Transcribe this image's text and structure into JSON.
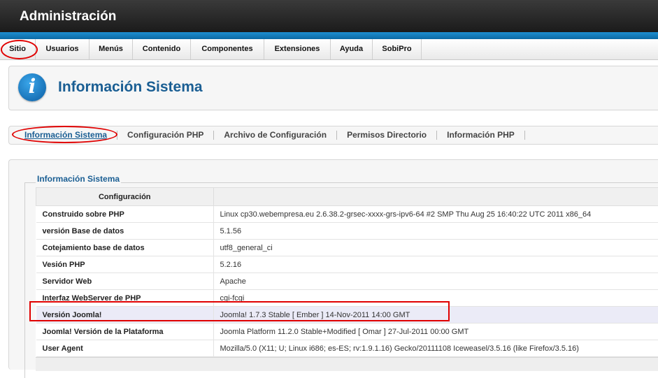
{
  "header": {
    "title": "Administración"
  },
  "menu": [
    "Sitio",
    "Usuarios",
    "Menús",
    "Contenido",
    "Componentes",
    "Extensiones",
    "Ayuda",
    "SobiPro"
  ],
  "page": {
    "title": "Información Sistema"
  },
  "tabs": [
    "Información Sistema",
    "Configuración PHP",
    "Archivo de Configuración",
    "Permisos Directorio",
    "Información PHP"
  ],
  "fieldset": {
    "legend": "Información Sistema"
  },
  "table": {
    "header": "Configuración",
    "rows": [
      {
        "k": "Construido sobre PHP",
        "v": "Linux cp30.webempresa.eu 2.6.38.2-grsec-xxxx-grs-ipv6-64 #2 SMP Thu Aug 25 16:40:22 UTC 2011 x86_64"
      },
      {
        "k": "versión Base de datos",
        "v": "5.1.56"
      },
      {
        "k": "Cotejamiento base de datos",
        "v": "utf8_general_ci"
      },
      {
        "k": "Vesión PHP",
        "v": "5.2.16"
      },
      {
        "k": "Servidor Web",
        "v": "Apache"
      },
      {
        "k": "Interfaz WebServer de PHP",
        "v": "cgi-fcgi"
      },
      {
        "k": "Versión Joomla!",
        "v": "Joomla! 1.7.3 Stable [ Ember ] 14-Nov-2011 14:00 GMT"
      },
      {
        "k": "Joomla! Versión de la Plataforma",
        "v": "Joomla Platform 11.2.0 Stable+Modified [ Omar ] 27-Jul-2011 00:00 GMT"
      },
      {
        "k": "User Agent",
        "v": "Mozilla/5.0 (X11; U; Linux i686; es-ES; rv:1.9.1.16) Gecko/20111108 Iceweasel/3.5.16 (like Firefox/3.5.16)"
      }
    ]
  },
  "colors": {
    "accent": "#1a5e93",
    "header": "#1b1b1b",
    "strip": "#0b6aa5",
    "annotation": "#e00000"
  },
  "icons": {
    "page": "info-icon"
  }
}
